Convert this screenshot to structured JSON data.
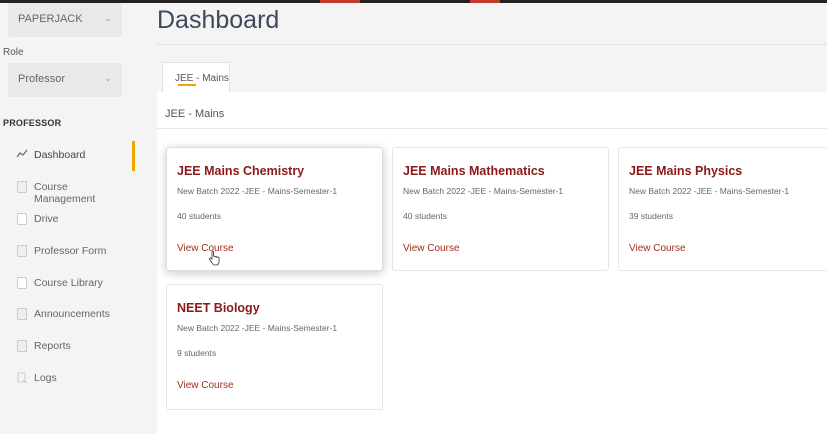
{
  "sidebar": {
    "org_select": {
      "value": "PAPERJACK"
    },
    "role_label": "Role",
    "role_select": {
      "value": "Professor"
    },
    "section_heading": "PROFESSOR",
    "items": [
      {
        "label": "Dashboard",
        "icon": "trend-line-icon",
        "active": true
      },
      {
        "label": "Course Management",
        "icon": "document-icon"
      },
      {
        "label": "Drive",
        "icon": "folder-icon"
      },
      {
        "label": "Professor Form",
        "icon": "document-icon"
      },
      {
        "label": "Course Library",
        "icon": "folder-icon"
      },
      {
        "label": "Announcements",
        "icon": "document-icon"
      },
      {
        "label": "Reports",
        "icon": "document-icon"
      },
      {
        "label": "Logs",
        "icon": "logs-icon"
      }
    ]
  },
  "main": {
    "title": "Dashboard",
    "tabs": [
      {
        "label": "JEE - Mains",
        "active": true
      }
    ],
    "section_heading": "JEE - Mains",
    "courses": [
      {
        "title": "JEE Mains Chemistry",
        "batch": "New Batch 2022 -JEE - Mains-Semester-1",
        "students": "40 students",
        "link": "View Course"
      },
      {
        "title": "JEE Mains Mathematics",
        "batch": "New Batch 2022 -JEE - Mains-Semester-1",
        "students": "40 students",
        "link": "View Course"
      },
      {
        "title": "JEE Mains Physics",
        "batch": "New Batch 2022 -JEE - Mains-Semester-1",
        "students": "39 students",
        "link": "View Course"
      },
      {
        "title": "NEET Biology",
        "batch": "New Batch 2022 -JEE - Mains-Semester-1",
        "students": "9 students",
        "link": "View Course"
      }
    ]
  },
  "colors": {
    "accent": "#f0a500",
    "course_title": "#8b1a1a",
    "link": "#a0301c"
  }
}
